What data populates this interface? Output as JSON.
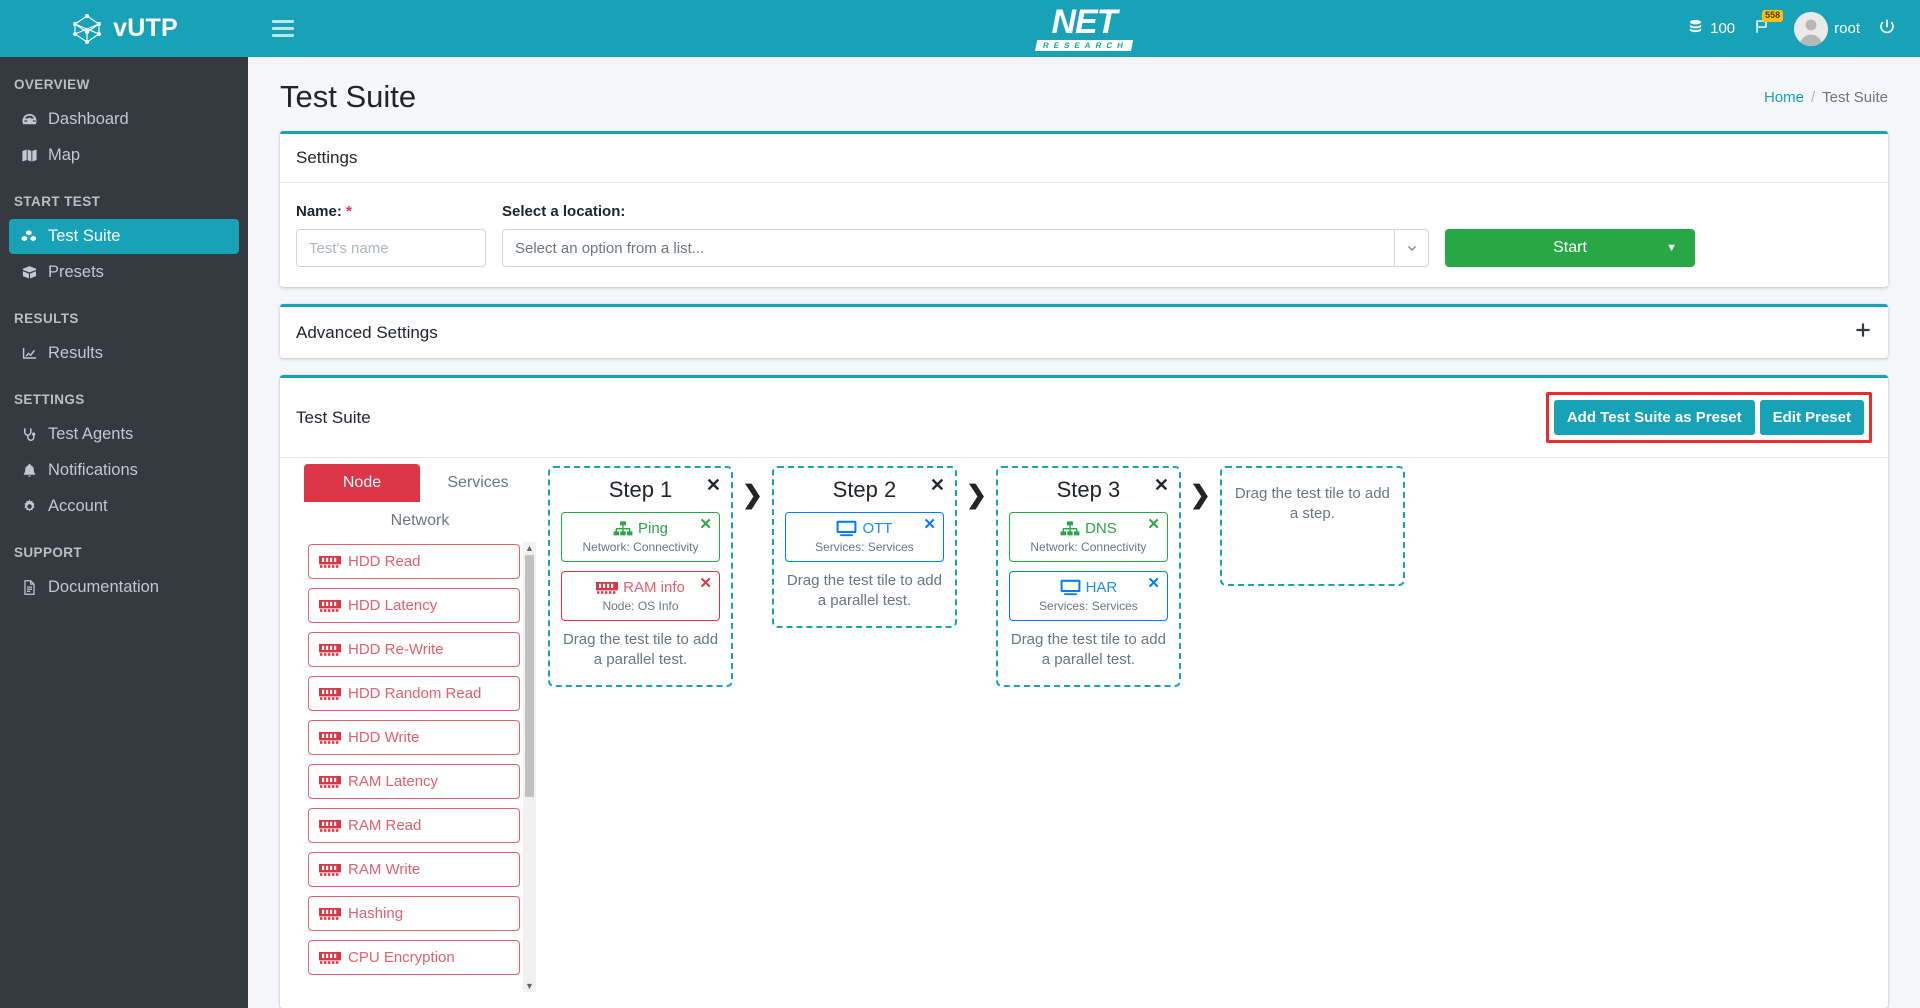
{
  "brand": {
    "name": "vUTP",
    "logo_icon": "network-node-logo-icon"
  },
  "topnav": {
    "menu_icon": "hamburger-menu-icon",
    "logo_main": "NET",
    "logo_sub": "RESEARCH",
    "credits_icon": "database-coins-icon",
    "credits": "100",
    "flag_icon": "flag-icon",
    "flag_badge": "558",
    "avatar_icon": "user-avatar-icon",
    "username": "root",
    "power_icon": "power-off-icon"
  },
  "sidebar": {
    "sections": [
      {
        "label": "OVERVIEW",
        "items": [
          {
            "label": "Dashboard",
            "icon": "tachometer-icon",
            "active": false
          },
          {
            "label": "Map",
            "icon": "map-icon",
            "active": false
          }
        ]
      },
      {
        "label": "START TEST",
        "items": [
          {
            "label": "Test Suite",
            "icon": "cubes-icon",
            "active": true
          },
          {
            "label": "Presets",
            "icon": "box-icon",
            "active": false
          }
        ]
      },
      {
        "label": "RESULTS",
        "items": [
          {
            "label": "Results",
            "icon": "chart-line-icon",
            "active": false
          }
        ]
      },
      {
        "label": "SETTINGS",
        "items": [
          {
            "label": "Test Agents",
            "icon": "stethoscope-icon",
            "active": false
          },
          {
            "label": "Notifications",
            "icon": "bell-icon",
            "active": false
          },
          {
            "label": "Account",
            "icon": "gear-icon",
            "active": false
          }
        ]
      },
      {
        "label": "SUPPORT",
        "items": [
          {
            "label": "Documentation",
            "icon": "file-lines-icon",
            "active": false
          }
        ]
      }
    ]
  },
  "page": {
    "title": "Test Suite",
    "breadcrumb": {
      "home": "Home",
      "separator": "/",
      "current": "Test Suite"
    }
  },
  "settings_card": {
    "title": "Settings",
    "name_label": "Name:",
    "name_required_mark": "*",
    "name_placeholder": "Test's name",
    "name_value": "",
    "location_label": "Select a location:",
    "location_placeholder": "Select an option from a list...",
    "location_value": "",
    "location_caret_icon": "chevron-down-icon",
    "start_label": "Start",
    "start_caret_icon": "caret-down-icon"
  },
  "advanced_card": {
    "title": "Advanced Settings",
    "expand_icon": "plus-icon"
  },
  "suite_card": {
    "title": "Test Suite",
    "add_preset_label": "Add Test Suite as Preset",
    "edit_preset_label": "Edit Preset",
    "highlight_color": "#ee2b2b"
  },
  "tile_panel": {
    "tabs": [
      {
        "label": "Node",
        "active": true
      },
      {
        "label": "Services",
        "active": false
      },
      {
        "label": "Network",
        "active": false
      }
    ],
    "tiles": [
      {
        "label": "HDD Read",
        "icon": "memory-stick-icon"
      },
      {
        "label": "HDD Latency",
        "icon": "memory-stick-icon"
      },
      {
        "label": "HDD Re-Write",
        "icon": "memory-stick-icon"
      },
      {
        "label": "HDD Random Read",
        "icon": "memory-stick-icon"
      },
      {
        "label": "HDD Write",
        "icon": "memory-stick-icon"
      },
      {
        "label": "RAM Latency",
        "icon": "memory-stick-icon"
      },
      {
        "label": "RAM Read",
        "icon": "memory-stick-icon"
      },
      {
        "label": "RAM Write",
        "icon": "memory-stick-icon"
      },
      {
        "label": "Hashing",
        "icon": "memory-stick-icon"
      },
      {
        "label": "CPU Encryption",
        "icon": "memory-stick-icon"
      }
    ],
    "scrollbar": {
      "up_icon": "caret-up-icon",
      "down_icon": "caret-down-icon"
    }
  },
  "steps": [
    {
      "title": "Step 1",
      "close_icon": "close-icon",
      "hint": "Drag the test tile to add a parallel test.",
      "tests": [
        {
          "name": "Ping",
          "category": "Network: Connectivity",
          "color": "green",
          "icon": "sitemap-icon",
          "close_icon": "close-icon"
        },
        {
          "name": "RAM info",
          "category": "Node: OS Info",
          "color": "red",
          "icon": "memory-stick-icon",
          "close_icon": "close-icon"
        }
      ]
    },
    {
      "title": "Step 2",
      "close_icon": "close-icon",
      "hint": "Drag the test tile to add a parallel test.",
      "tests": [
        {
          "name": "OTT",
          "category": "Services: Services",
          "color": "blue",
          "icon": "monitor-icon",
          "close_icon": "close-icon"
        }
      ]
    },
    {
      "title": "Step 3",
      "close_icon": "close-icon",
      "hint": "Drag the test tile to add a parallel test.",
      "tests": [
        {
          "name": "DNS",
          "category": "Network: Connectivity",
          "color": "green",
          "icon": "sitemap-icon",
          "close_icon": "close-icon"
        },
        {
          "name": "HAR",
          "category": "Services: Services",
          "color": "blue",
          "icon": "monitor-icon",
          "close_icon": "close-icon"
        }
      ]
    }
  ],
  "step_placeholder": {
    "hint": "Drag the test tile to add a step."
  },
  "step_arrow_icon": "chevron-right-icon",
  "colors": {
    "brand_teal": "#17a2b8",
    "sidebar_dark": "#343a40",
    "success_green": "#28a745",
    "danger_red": "#dc3545",
    "info_blue": "#007bff",
    "page_bg": "#f4f6f9"
  }
}
